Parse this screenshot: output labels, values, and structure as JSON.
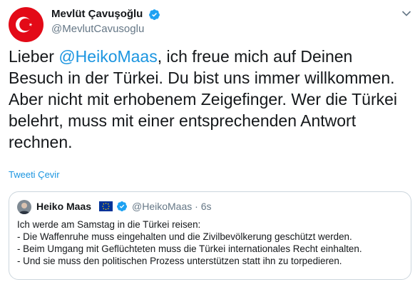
{
  "author": {
    "name": "Mevlüt Çavuşoğlu",
    "handle": "@MevlutCavusoglu",
    "avatar_icon": "turkey-flag-avatar",
    "verified": true
  },
  "tweet": {
    "text_before": "Lieber ",
    "mention": "@HeikoMaas",
    "text_after": ", ich freue mich auf Deinen Besuch in der Türkei. Du bist uns immer willkommen. Aber nicht mit erhobenem Zeigefinger. Wer die Türkei belehrt, muss mit einer entsprechenden Antwort rechnen."
  },
  "translate_label": "Tweeti Çevir",
  "quoted": {
    "name": "Heiko Maas",
    "handle": "@HeikoMaas",
    "separator": "·",
    "time": "6s",
    "lines": [
      "Ich werde am Samstag in die Türkei reisen:",
      "- Die Waffenruhe muss eingehalten und die Zivilbevölkerung geschützt werden.",
      "- Beim Umgang mit Geflüchteten muss die Türkei internationales Recht einhalten.",
      "- Und sie muss den politischen Prozess unterstützen statt ihn zu torpedieren."
    ]
  },
  "colors": {
    "link": "#1b95e0",
    "secondary_text": "#657786",
    "verified_badge": "#1da1f2",
    "border": "#ccd6dd",
    "turkey_red": "#e30a17",
    "eu_blue": "#003399"
  }
}
